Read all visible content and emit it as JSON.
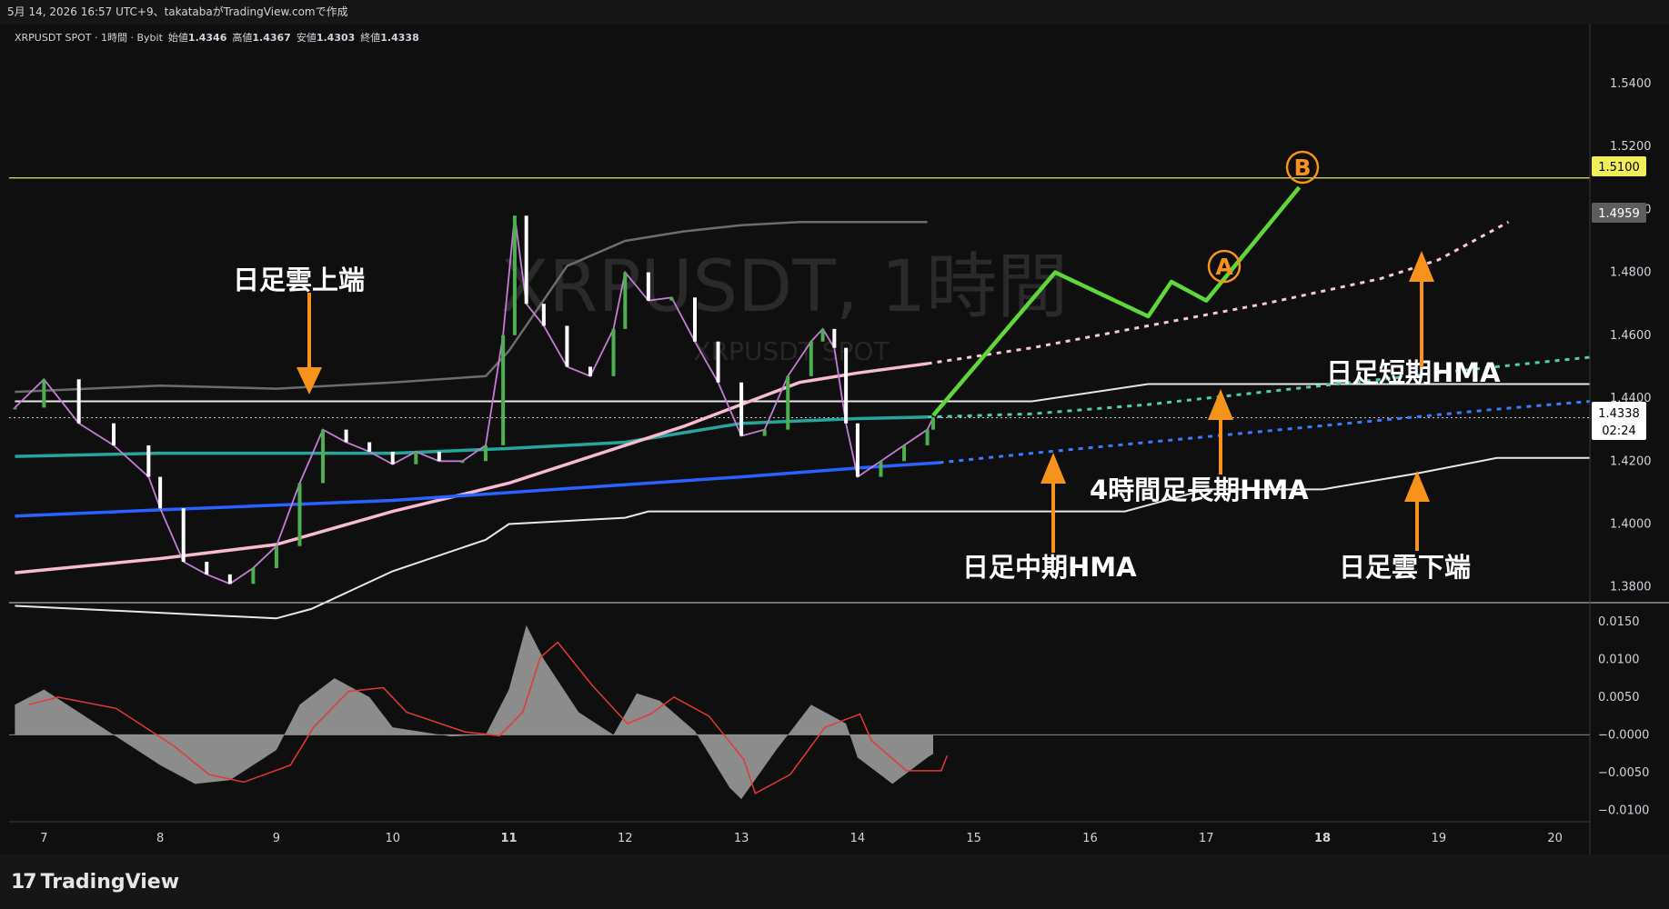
{
  "header": {
    "text": "5月 14, 2026 16:57 UTC+9、takatabaがTradingView.comで作成"
  },
  "legend": {
    "symbol": "XRPUSDT SPOT · 1時間 · Bybit",
    "open_label": "始値",
    "open": "1.4346",
    "high_label": "高値",
    "high": "1.4367",
    "low_label": "安値",
    "low": "1.4303",
    "close_label": "終値",
    "close": "1.4338"
  },
  "watermark": {
    "main": "XRPUSDT, 1時間",
    "sub": "XRPUSDT SPOT"
  },
  "brand": {
    "name": "TradingView",
    "mark": "17"
  },
  "price_axis": {
    "ticks": [
      "1.5400",
      "1.5200",
      "1.5000",
      "1.4800",
      "1.4600",
      "1.4400",
      "1.4200",
      "1.4000",
      "1.3800"
    ],
    "badge_resistance": "1.5100",
    "badge_hma": "1.4959",
    "badge_last": "1.4338",
    "badge_countdown": "02:24"
  },
  "osc_axis": {
    "ticks": [
      "0.0150",
      "0.0100",
      "0.0050",
      "−0.0000",
      "−0.0050",
      "−0.0100"
    ]
  },
  "time_axis": {
    "labels": [
      "7",
      "8",
      "9",
      "10",
      "11",
      "12",
      "13",
      "14",
      "15",
      "16",
      "17",
      "18",
      "19",
      "20"
    ],
    "bold": [
      "11",
      "18"
    ]
  },
  "annotations": {
    "cloud_top": "日足雲上端",
    "short_hma": "日足短期HMA",
    "long_hma_4h": "4時間足長期HMA",
    "mid_hma": "日足中期HMA",
    "cloud_bottom": "日足雲下端",
    "point_a": "A",
    "point_b": "B"
  },
  "colors": {
    "bg": "#0f0f0f",
    "resistance": "#e8e85a",
    "projection": "#5fd63a",
    "arrow": "#f7931a",
    "hma_long": "#2962ff",
    "hma_mid": "#f8bbd0",
    "hma_short": "#26a69a",
    "candle_up": "#4caf50",
    "candle_down": "#ffffff"
  },
  "chart_data": {
    "type": "line",
    "title": "XRPUSDT SPOT · 1時間 · Bybit",
    "ylim": [
      1.375,
      1.555
    ],
    "x_range": [
      6.7,
      20.3
    ],
    "levels": {
      "resistance": 1.51,
      "cloud_top": 1.439,
      "last_close": 1.4338
    },
    "series": [
      {
        "name": "price_close",
        "x": [
          6.75,
          7.0,
          7.3,
          7.6,
          7.9,
          8.0,
          8.2,
          8.4,
          8.6,
          8.8,
          9.0,
          9.2,
          9.4,
          9.6,
          9.8,
          10.0,
          10.2,
          10.4,
          10.6,
          10.8,
          10.95,
          11.05,
          11.15,
          11.3,
          11.5,
          11.7,
          11.9,
          12.0,
          12.2,
          12.4,
          12.6,
          12.8,
          13.0,
          13.2,
          13.4,
          13.6,
          13.7,
          13.8,
          13.9,
          14.0,
          14.2,
          14.4,
          14.6,
          14.65
        ],
        "values": [
          1.437,
          1.446,
          1.432,
          1.425,
          1.415,
          1.405,
          1.388,
          1.384,
          1.381,
          1.386,
          1.393,
          1.413,
          1.43,
          1.426,
          1.423,
          1.419,
          1.423,
          1.42,
          1.42,
          1.425,
          1.46,
          1.498,
          1.47,
          1.463,
          1.45,
          1.447,
          1.462,
          1.48,
          1.471,
          1.472,
          1.458,
          1.445,
          1.428,
          1.43,
          1.447,
          1.458,
          1.462,
          1.456,
          1.432,
          1.415,
          1.42,
          1.425,
          1.43,
          1.4338
        ]
      },
      {
        "name": "cloud_top",
        "x": [
          6.75,
          15.3,
          15.5,
          16.5,
          20.3
        ],
        "values": [
          1.439,
          1.439,
          1.439,
          1.4445,
          1.4445
        ]
      },
      {
        "name": "cloud_bottom",
        "x": [
          6.75,
          9.0,
          9.3,
          10.0,
          10.8,
          11.0,
          12.0,
          12.2,
          12.4,
          13.0,
          14.0,
          15.0,
          16.0,
          16.3,
          17.0,
          17.5,
          18.0,
          18.8,
          19.5,
          20.3
        ],
        "values": [
          1.374,
          1.37,
          1.373,
          1.385,
          1.395,
          1.4,
          1.402,
          1.404,
          1.404,
          1.404,
          1.404,
          1.404,
          1.404,
          1.404,
          1.411,
          1.411,
          1.411,
          1.416,
          1.421,
          1.421
        ]
      },
      {
        "name": "hma_long_4h",
        "x": [
          6.75,
          8.0,
          10.0,
          12.0,
          13.0,
          14.0,
          14.7
        ],
        "values": [
          1.4025,
          1.4045,
          1.4075,
          1.4125,
          1.415,
          1.4178,
          1.4195
        ]
      },
      {
        "name": "hma_long_4h_projection",
        "x": [
          14.7,
          15.5,
          16.5,
          17.5,
          18.5,
          19.5,
          20.3
        ],
        "values": [
          1.4195,
          1.4225,
          1.426,
          1.4295,
          1.433,
          1.4365,
          1.439
        ]
      },
      {
        "name": "hma_mid_daily",
        "x": [
          6.75,
          8.0,
          9.0,
          10.0,
          11.0,
          12.0,
          12.5,
          13.0,
          13.5,
          14.0,
          14.6
        ],
        "values": [
          1.3845,
          1.389,
          1.3935,
          1.404,
          1.413,
          1.425,
          1.431,
          1.438,
          1.445,
          1.448,
          1.451
        ]
      },
      {
        "name": "hma_mid_projection",
        "x": [
          14.6,
          15.5,
          16.5,
          17.5,
          18.5,
          19.0,
          19.6
        ],
        "values": [
          1.451,
          1.456,
          1.463,
          1.47,
          1.478,
          1.484,
          1.496
        ]
      },
      {
        "name": "hma_short_daily",
        "x": [
          6.75,
          8.0,
          9.0,
          10.0,
          11.0,
          12.0,
          12.5,
          13.0,
          14.0,
          14.6
        ],
        "values": [
          1.4215,
          1.4225,
          1.4225,
          1.4225,
          1.424,
          1.426,
          1.429,
          1.432,
          1.4335,
          1.434
        ]
      },
      {
        "name": "hma_short_projection",
        "x": [
          14.6,
          15.5,
          16.5,
          17.5,
          18.5,
          19.5,
          20.3
        ],
        "values": [
          1.434,
          1.435,
          1.438,
          1.442,
          1.446,
          1.45,
          1.453
        ]
      },
      {
        "name": "projection_path",
        "x": [
          14.65,
          15.7,
          16.5,
          16.7,
          17.0,
          17.8
        ],
        "values": [
          1.4345,
          1.48,
          1.466,
          1.477,
          1.471,
          1.507
        ]
      },
      {
        "name": "bb_upper",
        "x": [
          6.75,
          8.0,
          9.0,
          10.0,
          10.8,
          11.0,
          11.5,
          12.0,
          12.5,
          13.0,
          13.5,
          14.0,
          14.6
        ],
        "values": [
          1.442,
          1.444,
          1.443,
          1.445,
          1.447,
          1.455,
          1.482,
          1.49,
          1.493,
          1.495,
          1.496,
          1.496,
          1.496
        ]
      },
      {
        "name": "oscillator",
        "x": [
          6.75,
          7.0,
          7.5,
          8.0,
          8.3,
          8.6,
          9.0,
          9.2,
          9.5,
          9.8,
          10.0,
          10.5,
          10.8,
          11.0,
          11.15,
          11.3,
          11.6,
          11.9,
          12.1,
          12.3,
          12.6,
          12.9,
          13.0,
          13.3,
          13.6,
          13.9,
          14.0,
          14.3,
          14.6,
          14.65
        ],
        "values": [
          0.004,
          0.006,
          0.001,
          -0.004,
          -0.0065,
          -0.006,
          -0.002,
          0.004,
          0.0075,
          0.005,
          0.001,
          -0.0002,
          0.0,
          0.006,
          0.0145,
          0.01,
          0.003,
          0.0,
          0.0055,
          0.0045,
          0.0005,
          -0.007,
          -0.0085,
          -0.002,
          0.004,
          0.0015,
          -0.003,
          -0.0065,
          -0.003,
          -0.0025
        ]
      }
    ]
  }
}
